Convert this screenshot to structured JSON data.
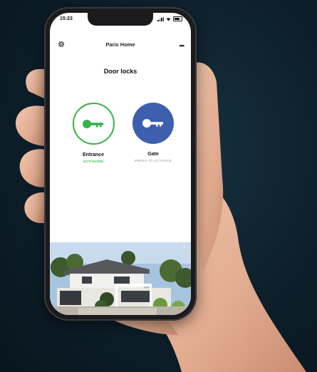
{
  "status_bar": {
    "time": "15:23"
  },
  "header": {
    "title": "Paris Home",
    "settings_icon": "gear-icon",
    "more_icon": "more-dots-icon",
    "more_label": "•••"
  },
  "section": {
    "title": "Door locks"
  },
  "locks": [
    {
      "name": "Entrance",
      "status": "ACTIVATED",
      "icon": "key-icon",
      "style": "outline",
      "color": "#36b24b"
    },
    {
      "name": "Gate",
      "status": "PRESS TO ACTIVATE",
      "icon": "key-icon",
      "style": "filled",
      "color": "#3e5fae"
    }
  ],
  "photo": {
    "description_icon": "house-photo",
    "collapse_icon": "chevron-up-icon",
    "collapse_label": "⌃"
  }
}
